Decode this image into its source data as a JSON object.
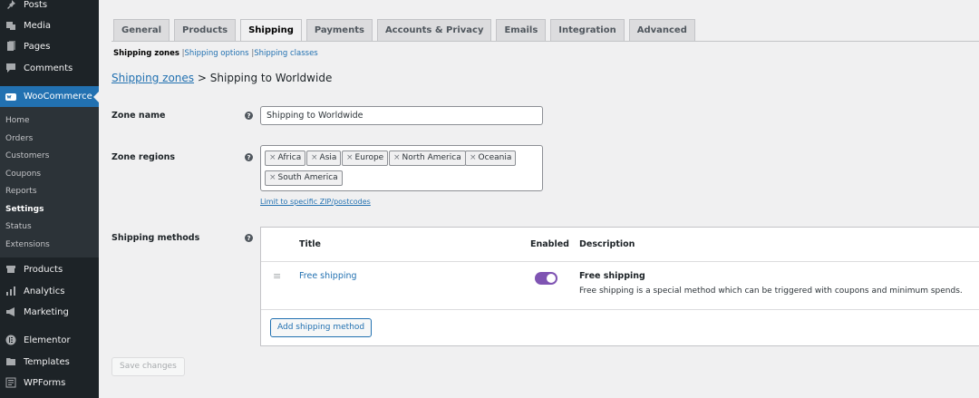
{
  "sidebar": {
    "top_items": [
      {
        "label": "Posts",
        "icon": "pin-icon"
      },
      {
        "label": "Media",
        "icon": "media-icon"
      },
      {
        "label": "Pages",
        "icon": "pages-icon"
      },
      {
        "label": "Comments",
        "icon": "comment-icon"
      }
    ],
    "woocommerce": {
      "label": "WooCommerce",
      "icon": "woocommerce-icon"
    },
    "submenu": [
      "Home",
      "Orders",
      "Customers",
      "Coupons",
      "Reports",
      "Settings",
      "Status",
      "Extensions"
    ],
    "current_submenu": "Settings",
    "bottom_items": [
      {
        "label": "Products",
        "icon": "products-icon"
      },
      {
        "label": "Analytics",
        "icon": "analytics-icon"
      },
      {
        "label": "Marketing",
        "icon": "megaphone-icon"
      },
      {
        "label": "Elementor",
        "icon": "elementor-icon"
      },
      {
        "label": "Templates",
        "icon": "folder-icon"
      },
      {
        "label": "WPForms",
        "icon": "forms-icon"
      }
    ]
  },
  "tabs": [
    "General",
    "Products",
    "Shipping",
    "Payments",
    "Accounts & Privacy",
    "Emails",
    "Integration",
    "Advanced"
  ],
  "active_tab": "Shipping",
  "subsub": {
    "current": "Shipping zones",
    "links": [
      "Shipping options",
      "Shipping classes"
    ],
    "separator": "|"
  },
  "heading": {
    "link": "Shipping zones",
    "separator": ">",
    "title": "Shipping to Worldwide"
  },
  "zone_name": {
    "label": "Zone name",
    "value": "Shipping to Worldwide"
  },
  "zone_regions": {
    "label": "Zone regions",
    "chips": [
      "Africa",
      "Asia",
      "Europe",
      "North America",
      "Oceania",
      "South America"
    ],
    "remove_glyph": "×",
    "limit_link": "Limit to specific ZIP/postcodes"
  },
  "shipping_methods": {
    "label": "Shipping methods",
    "headers": {
      "title": "Title",
      "enabled": "Enabled",
      "description": "Description"
    },
    "rows": [
      {
        "title": "Free shipping",
        "enabled": true,
        "desc_title": "Free shipping",
        "desc_text": "Free shipping is a special method which can be triggered with coupons and minimum spends."
      }
    ],
    "add_button": "Add shipping method"
  },
  "save_button": "Save changes",
  "help_glyph": "?",
  "colors": {
    "accent": "#2271b1",
    "sidebar": "#1d2327",
    "toggle": "#7f54b3"
  }
}
